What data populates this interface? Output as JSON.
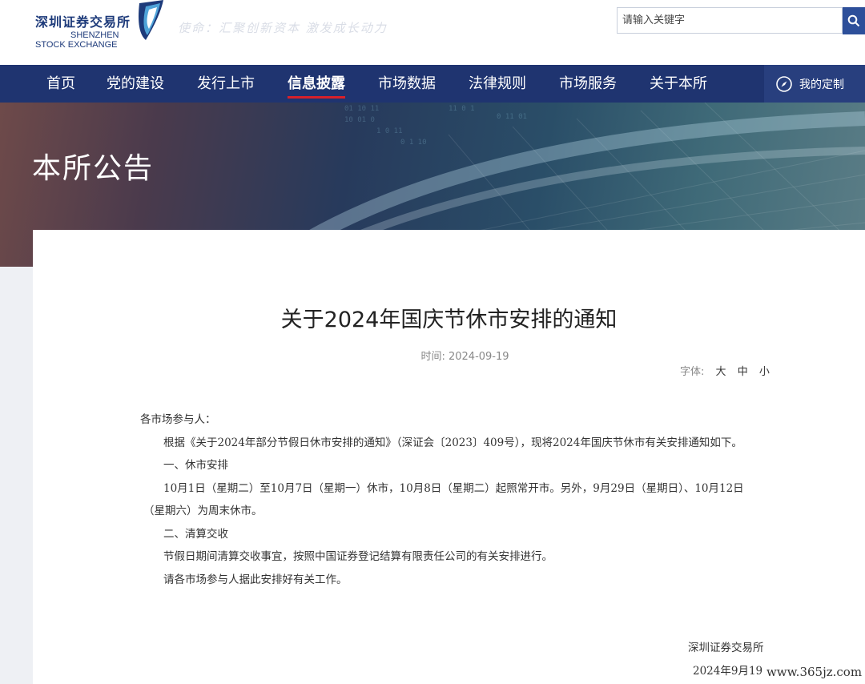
{
  "header": {
    "logo_cn": "深圳证券交易所",
    "logo_en_1": "SHENZHEN",
    "logo_en_2": "STOCK EXCHANGE",
    "slogan": "使命：汇聚创新资本 激发成长动力",
    "search_placeholder": "请输入关键字",
    "brand_color": "#1f3470"
  },
  "nav": {
    "items": [
      {
        "label": "首页"
      },
      {
        "label": "党的建设"
      },
      {
        "label": "发行上市"
      },
      {
        "label": "信息披露",
        "active": true
      },
      {
        "label": "市场数据"
      },
      {
        "label": "法律规则"
      },
      {
        "label": "市场服务"
      },
      {
        "label": "关于本所"
      }
    ],
    "custom_label": "我的定制",
    "active_indicator_color": "#d7202a"
  },
  "banner": {
    "title": "本所公告"
  },
  "article": {
    "title": "关于2024年国庆节休市安排的通知",
    "time_label": "时间:",
    "time_value": "2024-09-19",
    "font_label": "字体:",
    "font_options": [
      "大",
      "中",
      "小"
    ],
    "paragraphs": [
      "各市场参与人：",
      "根据《关于2024年部分节假日休市安排的通知》（深证会〔2023〕409号），现将2024年国庆节休市有关安排通知如下。",
      "一、休市安排",
      "10月1日（星期二）至10月7日（星期一）休市，10月8日（星期二）起照常开市。另外，9月29日（星期日）、10月12日",
      "（星期六）为周末休市。",
      "二、清算交收",
      "节假日期间清算交收事宜，按照中国证券登记结算有限责任公司的有关安排进行。",
      "请各市场参与人据此安排好有关工作。"
    ],
    "signature_org": "深圳证券交易所",
    "signature_date": "2024年9月19日"
  },
  "watermark": "www.365jz.com"
}
